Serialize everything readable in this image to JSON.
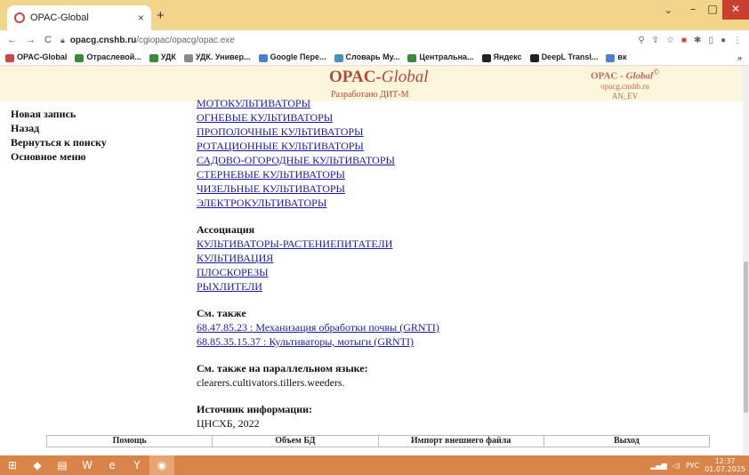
{
  "browser": {
    "tab_title": "OPAC-Global",
    "tab_close": "×",
    "new_tab": "+",
    "url_host": "opacg.cnshb.ru",
    "url_path": "/cgiopac/opacg/opac.exe",
    "bookmarks": [
      "OPAC-Global",
      "Отраслевой...",
      "УДК",
      "УДК. Универ...",
      "Google Пере...",
      "Словарь Му...",
      "Центральна...",
      "Яндекс",
      "DeepL Transl...",
      "вк"
    ],
    "bookmark_colors": [
      "#c44",
      "#3a8a3a",
      "#3a8a3a",
      "#888",
      "#4a7fd6",
      "#4a90c0",
      "#3a8a3a",
      "#222",
      "#222",
      "#4a7fd6"
    ]
  },
  "header": {
    "brand_main": "OPAC-",
    "brand_italic": "Global",
    "developer": "Разработано ДИТ-М",
    "logo2_main": "OPAC - ",
    "logo2_italic": "Global",
    "logo2_mark": "©",
    "logo2_host": "opacg.cnshb.ru",
    "logo2_code": "AN_EV"
  },
  "sidebar": {
    "items": [
      "Новая запись",
      "Назад",
      "Вернуться к поиску",
      "Основное меню"
    ]
  },
  "content": {
    "narrower_terms": [
      "МОТОКУЛЬТИВАТОРЫ",
      "ОГНЕВЫЕ КУЛЬТИВАТОРЫ",
      "ПРОПОЛОЧНЫЕ КУЛЬТИВАТОРЫ",
      "РОТАЦИОННЫЕ КУЛЬТИВАТОРЫ",
      "САДОВО-ОГОРОДНЫЕ КУЛЬТИВАТОРЫ",
      "СТЕРНЕВЫЕ КУЛЬТИВАТОРЫ",
      "ЧИЗЕЛЬНЫЕ КУЛЬТИВАТОРЫ",
      "ЭЛЕКТРОКУЛЬТИВАТОРЫ"
    ],
    "association_heading": "Ассоциация",
    "association_terms": [
      "КУЛЬТИВАТОРЫ-РАСТЕНИЕПИТАТЕЛИ",
      "КУЛЬТИВАЦИЯ",
      "ПЛОСКОРЕЗЫ",
      "РЫХЛИТЕЛИ"
    ],
    "see_also_heading": "См. также",
    "see_also": [
      "68.47.85.23 : Механизация обработки почвы (GRNTI)",
      "68.85.35.15.37 : Культиваторы, мотыги (GRNTI)"
    ],
    "parallel_heading": "См. также на параллельном языке:",
    "parallel_value": "clearers.cultivators.tillers.weeders.",
    "source_heading": "Источник информации:",
    "source_value": "ЦНСХБ, 2022"
  },
  "footer": {
    "items": [
      "Помощь",
      "Объем БД",
      "Импорт внешнего файла",
      "Выход"
    ]
  },
  "taskbar": {
    "lang": "РУС",
    "time": "12:37",
    "date": "01.07.2025"
  }
}
